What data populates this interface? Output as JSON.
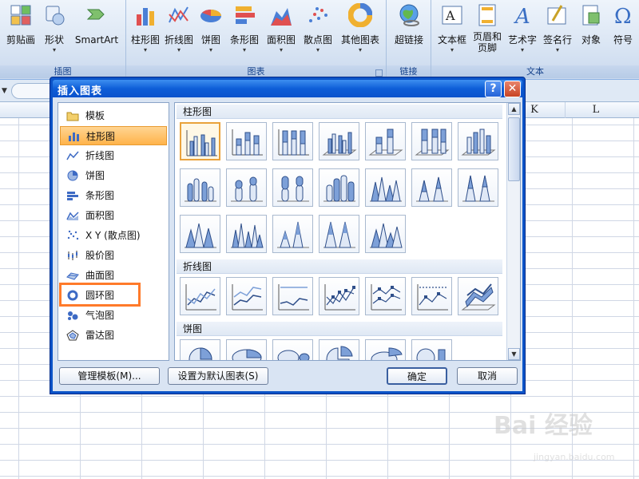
{
  "ribbon": {
    "groups": [
      {
        "label": "插图"
      },
      {
        "label": "图表"
      },
      {
        "label": "链接"
      },
      {
        "label": "文本"
      }
    ],
    "buttons": [
      {
        "label": "剪贴画"
      },
      {
        "label": "形状"
      },
      {
        "label": "SmartArt"
      },
      {
        "label": "柱形图"
      },
      {
        "label": "折线图"
      },
      {
        "label": "饼图"
      },
      {
        "label": "条形图"
      },
      {
        "label": "面积图"
      },
      {
        "label": "散点图"
      },
      {
        "label": "其他图表"
      },
      {
        "label": "超链接"
      },
      {
        "label": "文本框"
      },
      {
        "label": "页眉和\n页脚"
      },
      {
        "label": "艺术字"
      },
      {
        "label": "签名行"
      },
      {
        "label": "对象"
      },
      {
        "label": "符号"
      }
    ],
    "dropdown_arrow": "▾"
  },
  "sheet": {
    "columns": [
      "K",
      "L"
    ]
  },
  "dialog": {
    "title": "插入图表",
    "help": "?",
    "close": "✕",
    "types": [
      {
        "label": "模板",
        "icon": "folder-icon"
      },
      {
        "label": "柱形图",
        "icon": "column-chart-icon",
        "selected": true
      },
      {
        "label": "折线图",
        "icon": "line-chart-icon"
      },
      {
        "label": "饼图",
        "icon": "pie-chart-icon"
      },
      {
        "label": "条形图",
        "icon": "bar-chart-icon"
      },
      {
        "label": "面积图",
        "icon": "area-chart-icon"
      },
      {
        "label": "X Y (散点图)",
        "icon": "scatter-chart-icon"
      },
      {
        "label": "股价图",
        "icon": "stock-chart-icon"
      },
      {
        "label": "曲面图",
        "icon": "surface-chart-icon"
      },
      {
        "label": "圆环图",
        "icon": "doughnut-chart-icon"
      },
      {
        "label": "气泡图",
        "icon": "bubble-chart-icon"
      },
      {
        "label": "雷达图",
        "icon": "radar-chart-icon"
      }
    ],
    "sections": [
      {
        "label": "柱形图"
      },
      {
        "label": "折线图"
      },
      {
        "label": "饼图"
      }
    ],
    "buttons": {
      "manage_templates": "管理模板(M)...",
      "set_default": "设置为默认图表(S)",
      "ok": "确定",
      "cancel": "取消"
    }
  },
  "watermark": {
    "brand": "Bai 经验",
    "url": "jingyan.baidu.com"
  }
}
